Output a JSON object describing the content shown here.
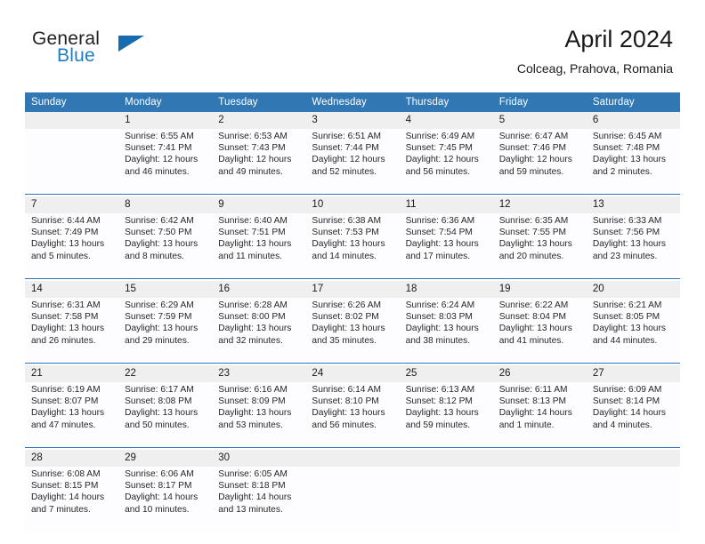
{
  "brand": {
    "word_one": "General",
    "word_two": "Blue",
    "triangle_icon": "triangle-icon",
    "colors": {
      "text": "#231f20",
      "accent": "#1f7cc0"
    }
  },
  "header": {
    "title": "April 2024",
    "subtitle": "Colceag, Prahova, Romania"
  },
  "theme": {
    "header_blue": "#3077b4",
    "separator_blue": "#2e75b6",
    "daynum_band": "#efefef",
    "cell_background": "#fdfdff"
  },
  "labels": {
    "sunrise_prefix": "Sunrise:",
    "sunset_prefix": "Sunset:",
    "daylight_prefix": "Daylight:"
  },
  "weekday_headers": [
    "Sunday",
    "Monday",
    "Tuesday",
    "Wednesday",
    "Thursday",
    "Friday",
    "Saturday"
  ],
  "weeks": [
    {
      "days": [
        {
          "num": "",
          "l1": "",
          "l2": "",
          "l3": "",
          "l4": ""
        },
        {
          "num": "1",
          "l1": "Sunrise: 6:55 AM",
          "l2": "Sunset: 7:41 PM",
          "l3": "Daylight: 12 hours",
          "l4": "and 46 minutes."
        },
        {
          "num": "2",
          "l1": "Sunrise: 6:53 AM",
          "l2": "Sunset: 7:43 PM",
          "l3": "Daylight: 12 hours",
          "l4": "and 49 minutes."
        },
        {
          "num": "3",
          "l1": "Sunrise: 6:51 AM",
          "l2": "Sunset: 7:44 PM",
          "l3": "Daylight: 12 hours",
          "l4": "and 52 minutes."
        },
        {
          "num": "4",
          "l1": "Sunrise: 6:49 AM",
          "l2": "Sunset: 7:45 PM",
          "l3": "Daylight: 12 hours",
          "l4": "and 56 minutes."
        },
        {
          "num": "5",
          "l1": "Sunrise: 6:47 AM",
          "l2": "Sunset: 7:46 PM",
          "l3": "Daylight: 12 hours",
          "l4": "and 59 minutes."
        },
        {
          "num": "6",
          "l1": "Sunrise: 6:45 AM",
          "l2": "Sunset: 7:48 PM",
          "l3": "Daylight: 13 hours",
          "l4": "and 2 minutes."
        }
      ]
    },
    {
      "days": [
        {
          "num": "7",
          "l1": "Sunrise: 6:44 AM",
          "l2": "Sunset: 7:49 PM",
          "l3": "Daylight: 13 hours",
          "l4": "and 5 minutes."
        },
        {
          "num": "8",
          "l1": "Sunrise: 6:42 AM",
          "l2": "Sunset: 7:50 PM",
          "l3": "Daylight: 13 hours",
          "l4": "and 8 minutes."
        },
        {
          "num": "9",
          "l1": "Sunrise: 6:40 AM",
          "l2": "Sunset: 7:51 PM",
          "l3": "Daylight: 13 hours",
          "l4": "and 11 minutes."
        },
        {
          "num": "10",
          "l1": "Sunrise: 6:38 AM",
          "l2": "Sunset: 7:53 PM",
          "l3": "Daylight: 13 hours",
          "l4": "and 14 minutes."
        },
        {
          "num": "11",
          "l1": "Sunrise: 6:36 AM",
          "l2": "Sunset: 7:54 PM",
          "l3": "Daylight: 13 hours",
          "l4": "and 17 minutes."
        },
        {
          "num": "12",
          "l1": "Sunrise: 6:35 AM",
          "l2": "Sunset: 7:55 PM",
          "l3": "Daylight: 13 hours",
          "l4": "and 20 minutes."
        },
        {
          "num": "13",
          "l1": "Sunrise: 6:33 AM",
          "l2": "Sunset: 7:56 PM",
          "l3": "Daylight: 13 hours",
          "l4": "and 23 minutes."
        }
      ]
    },
    {
      "days": [
        {
          "num": "14",
          "l1": "Sunrise: 6:31 AM",
          "l2": "Sunset: 7:58 PM",
          "l3": "Daylight: 13 hours",
          "l4": "and 26 minutes."
        },
        {
          "num": "15",
          "l1": "Sunrise: 6:29 AM",
          "l2": "Sunset: 7:59 PM",
          "l3": "Daylight: 13 hours",
          "l4": "and 29 minutes."
        },
        {
          "num": "16",
          "l1": "Sunrise: 6:28 AM",
          "l2": "Sunset: 8:00 PM",
          "l3": "Daylight: 13 hours",
          "l4": "and 32 minutes."
        },
        {
          "num": "17",
          "l1": "Sunrise: 6:26 AM",
          "l2": "Sunset: 8:02 PM",
          "l3": "Daylight: 13 hours",
          "l4": "and 35 minutes."
        },
        {
          "num": "18",
          "l1": "Sunrise: 6:24 AM",
          "l2": "Sunset: 8:03 PM",
          "l3": "Daylight: 13 hours",
          "l4": "and 38 minutes."
        },
        {
          "num": "19",
          "l1": "Sunrise: 6:22 AM",
          "l2": "Sunset: 8:04 PM",
          "l3": "Daylight: 13 hours",
          "l4": "and 41 minutes."
        },
        {
          "num": "20",
          "l1": "Sunrise: 6:21 AM",
          "l2": "Sunset: 8:05 PM",
          "l3": "Daylight: 13 hours",
          "l4": "and 44 minutes."
        }
      ]
    },
    {
      "days": [
        {
          "num": "21",
          "l1": "Sunrise: 6:19 AM",
          "l2": "Sunset: 8:07 PM",
          "l3": "Daylight: 13 hours",
          "l4": "and 47 minutes."
        },
        {
          "num": "22",
          "l1": "Sunrise: 6:17 AM",
          "l2": "Sunset: 8:08 PM",
          "l3": "Daylight: 13 hours",
          "l4": "and 50 minutes."
        },
        {
          "num": "23",
          "l1": "Sunrise: 6:16 AM",
          "l2": "Sunset: 8:09 PM",
          "l3": "Daylight: 13 hours",
          "l4": "and 53 minutes."
        },
        {
          "num": "24",
          "l1": "Sunrise: 6:14 AM",
          "l2": "Sunset: 8:10 PM",
          "l3": "Daylight: 13 hours",
          "l4": "and 56 minutes."
        },
        {
          "num": "25",
          "l1": "Sunrise: 6:13 AM",
          "l2": "Sunset: 8:12 PM",
          "l3": "Daylight: 13 hours",
          "l4": "and 59 minutes."
        },
        {
          "num": "26",
          "l1": "Sunrise: 6:11 AM",
          "l2": "Sunset: 8:13 PM",
          "l3": "Daylight: 14 hours",
          "l4": "and 1 minute."
        },
        {
          "num": "27",
          "l1": "Sunrise: 6:09 AM",
          "l2": "Sunset: 8:14 PM",
          "l3": "Daylight: 14 hours",
          "l4": "and 4 minutes."
        }
      ]
    },
    {
      "days": [
        {
          "num": "28",
          "l1": "Sunrise: 6:08 AM",
          "l2": "Sunset: 8:15 PM",
          "l3": "Daylight: 14 hours",
          "l4": "and 7 minutes."
        },
        {
          "num": "29",
          "l1": "Sunrise: 6:06 AM",
          "l2": "Sunset: 8:17 PM",
          "l3": "Daylight: 14 hours",
          "l4": "and 10 minutes."
        },
        {
          "num": "30",
          "l1": "Sunrise: 6:05 AM",
          "l2": "Sunset: 8:18 PM",
          "l3": "Daylight: 14 hours",
          "l4": "and 13 minutes."
        },
        {
          "num": "",
          "l1": "",
          "l2": "",
          "l3": "",
          "l4": ""
        },
        {
          "num": "",
          "l1": "",
          "l2": "",
          "l3": "",
          "l4": ""
        },
        {
          "num": "",
          "l1": "",
          "l2": "",
          "l3": "",
          "l4": ""
        },
        {
          "num": "",
          "l1": "",
          "l2": "",
          "l3": "",
          "l4": ""
        }
      ]
    }
  ]
}
